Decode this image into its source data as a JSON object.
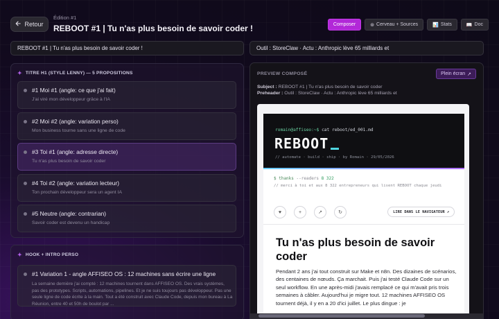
{
  "header": {
    "back_label": "Retour",
    "back_icon": "arrow-left-icon",
    "edition": "Édition #1",
    "title": "REBOOT #1 | Tu n'as plus besoin de savoir coder !",
    "tabs": [
      {
        "label": "Composer",
        "icon": "",
        "active": true
      },
      {
        "label": "Cerveau + Sources",
        "icon": "⊛",
        "active": false
      },
      {
        "label": "Stats",
        "icon": "📊",
        "active": false
      },
      {
        "label": "Doc",
        "icon": "📖",
        "active": false
      }
    ]
  },
  "subject_field": {
    "value": "REBOOT #1 | Tu n'as plus besoin de savoir coder !"
  },
  "preheader_field": {
    "value": "Outil : StoreClaw · Actu : Anthropic lève 65 milliards et"
  },
  "title_panel": {
    "heading": "TITRE H1 (STYLE LENNY) — 5 PROPOSITIONS",
    "items": [
      {
        "title": "#1  Moi #1 (angle: ce que j'ai fait)",
        "sub": "J'ai viré mon développeur grâce à l'IA",
        "selected": false
      },
      {
        "title": "#2  Moi #2 (angle: variation perso)",
        "sub": "Mon business tourne sans une ligne de code",
        "selected": false
      },
      {
        "title": "#3  Toi #1 (angle: adresse directe)",
        "sub": "Tu n'as plus besoin de savoir coder",
        "selected": true
      },
      {
        "title": "#4  Toi #2 (angle: variation lecteur)",
        "sub": "Ton prochain développeur sera un agent IA",
        "selected": false
      },
      {
        "title": "#5  Neutre (angle: contrarian)",
        "sub": "Savoir coder est devenu un handicap",
        "selected": false
      }
    ]
  },
  "hook_panel": {
    "heading": "HOOK + INTRO PERSO",
    "items": [
      {
        "title": "#1  Variation 1 - angle AFFISEO OS : 12 machines sans écrire une ligne",
        "desc": "La semaine dernière j'ai compté : 12 machines tournent dans AFFISEO OS. Des vrais systèmes, pas des prototypes. Scripts, automations, pipelines. Et je ne suis toujours pas développeur. Pas une seule ligne de code écrite à la main. Tout a été construit avec Claude Code, depuis mon bureau à La Réunion, entre 40 et 50h de boulot par ..."
      }
    ]
  },
  "preview": {
    "label": "PREVIEW COMPOSÉ",
    "fullscreen_label": "Plein écran",
    "fullscreen_icon": "↗",
    "subject_key": "Subject :",
    "subject_value": "REBOOT #1 | Tu n'as plus besoin de savoir coder",
    "preheader_key": "Preheader :",
    "preheader_value": "Outil : StoreClaw · Actu : Anthropic lève 65 milliards et",
    "email": {
      "prompt_user": "romain@affiseo:~$",
      "prompt_cmd": " cat reboot/ed_001.md",
      "brand": "REBOOT",
      "tagline": "// automate · build · ship · by Romain · 29/05/2026",
      "thanks_dollar": "$ thanks",
      "thanks_flag": " --readers ",
      "thanks_count": "8 322",
      "thanks_sub": "// merci à toi et aux 8 322 entrepreneurs qui lisent REBOOT chaque jeudi",
      "actions": [
        "♥",
        "+",
        "↗",
        "↻"
      ],
      "browser_label": "LIRE DANS LE NAVIGATEUR",
      "browser_icon": "↗",
      "article_title": "Tu n'as plus besoin de savoir coder",
      "article_body": "Pendant 2 ans j'ai tout construit sur Make et n8n. Des dizaines de scénarios, des centaines de nœuds. Ça marchait. Puis j'ai testé Claude Code sur un seul workflow. En une après-midi j'avais remplacé ce qui m'avait pris trois semaines à câbler. Aujourd'hui je migre tout. 12 machines AFFISEO OS tournent déjà, il y en a 20 d'ici juillet. Le plus dingue : je"
    }
  }
}
